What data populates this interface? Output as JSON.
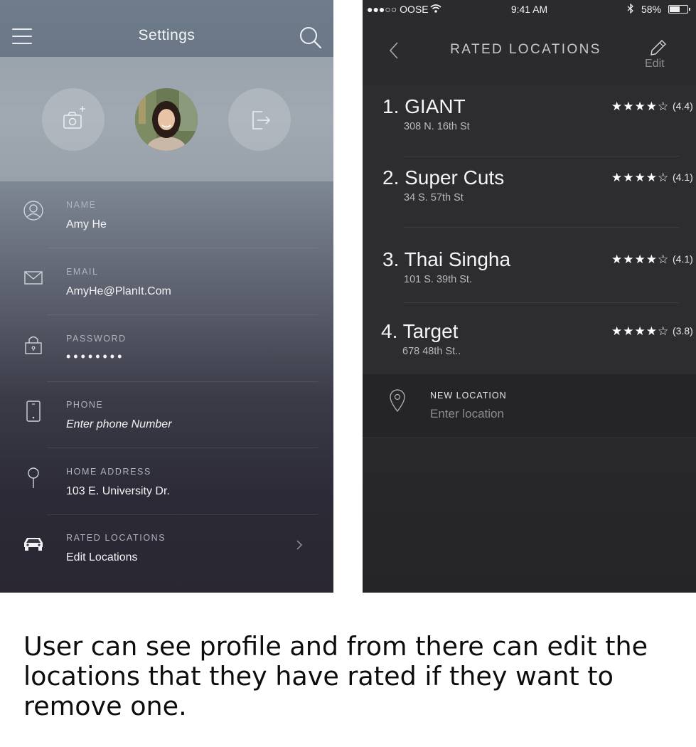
{
  "settings": {
    "title": "Settings",
    "fields": [
      {
        "label": "NAME",
        "value": "Amy He"
      },
      {
        "label": "EMAIL",
        "value": "AmyHe@PlanIt.Com"
      },
      {
        "label": "PASSWORD",
        "value": "••••••••"
      },
      {
        "label": "PHONE",
        "value": "Enter phone Number"
      },
      {
        "label": "HOME ADDRESS",
        "value": "103 E. University Dr."
      },
      {
        "label": "RATED LOCATIONS",
        "value": "Edit Locations"
      }
    ]
  },
  "status_bar": {
    "carrier": "●●●○○ OOSE",
    "time": "9:41 AM",
    "battery": "58%"
  },
  "rated_locations": {
    "title": "RATED LOCATIONS",
    "edit_label": "Edit",
    "items": [
      {
        "name": "1. GIANT",
        "address": "308 N. 16th St",
        "stars": "★★★★☆",
        "rating": "(4.4)"
      },
      {
        "name": "2. Super Cuts",
        "address": "34 S. 57th St",
        "stars": "★★★★☆",
        "rating": "(4.1)"
      },
      {
        "name": "3. Thai Singha",
        "address": "101 S. 39th St.",
        "stars": "★★★★☆",
        "rating": "(4.1)"
      },
      {
        "name": "4. Target",
        "address": "678 48th St..",
        "stars": "★★★★☆",
        "rating": "(3.8)"
      }
    ],
    "new_location": {
      "label": "NEW LOCATION",
      "placeholder": "Enter location"
    }
  },
  "caption": "User can see profile and from there can edit the locations that they have rated if they want to remove one."
}
